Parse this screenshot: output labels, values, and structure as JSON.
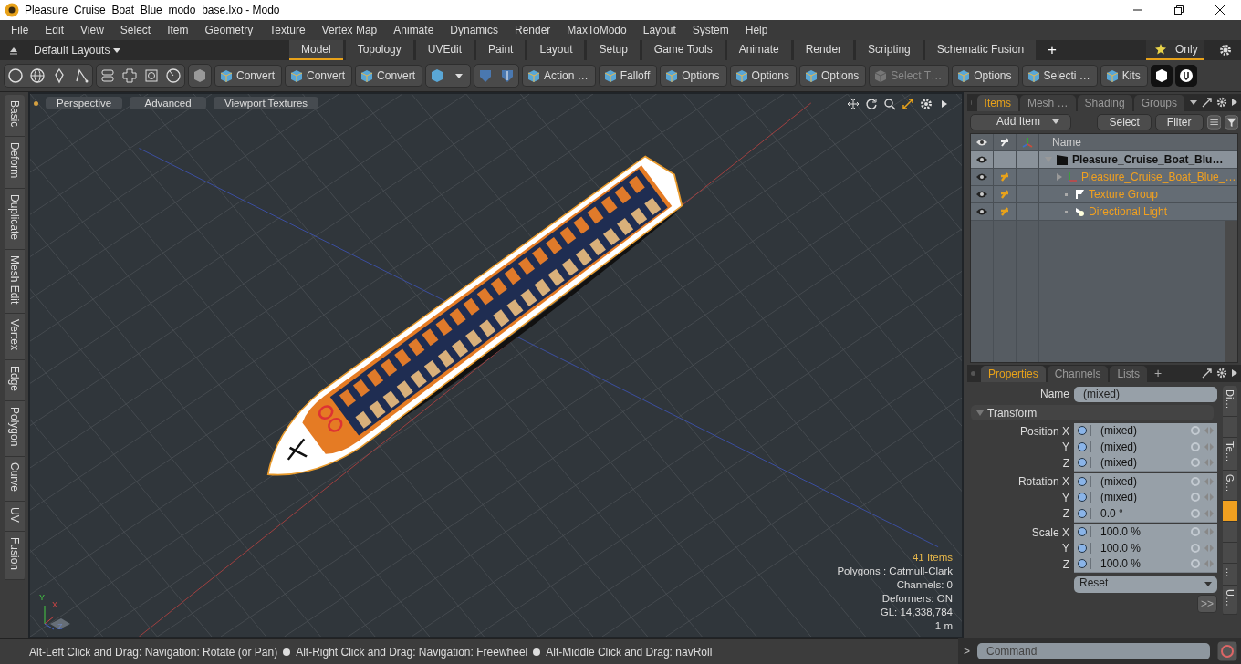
{
  "window": {
    "title": "Pleasure_Cruise_Boat_Blue_modo_base.lxo - Modo"
  },
  "menu": [
    "File",
    "Edit",
    "View",
    "Select",
    "Item",
    "Geometry",
    "Texture",
    "Vertex Map",
    "Animate",
    "Dynamics",
    "Render",
    "MaxToModo",
    "Layout",
    "System",
    "Help"
  ],
  "layout_bar": {
    "layouts": "Default Layouts",
    "tabs": [
      {
        "label": "Model",
        "selected": true
      },
      {
        "label": "Topology",
        "selected": false
      },
      {
        "label": "UVEdit",
        "selected": false
      },
      {
        "label": "Paint",
        "selected": false
      },
      {
        "label": "Layout",
        "selected": false
      },
      {
        "label": "Setup",
        "selected": false
      },
      {
        "label": "Game Tools",
        "selected": false
      },
      {
        "label": "Animate",
        "selected": false
      },
      {
        "label": "Render",
        "selected": false
      },
      {
        "label": "Scripting",
        "selected": false
      },
      {
        "label": "Schematic Fusion",
        "selected": false
      }
    ],
    "add": "+",
    "only": "Only"
  },
  "toolbar": {
    "buttons": [
      {
        "label": "Convert",
        "disabled": false
      },
      {
        "label": "Convert",
        "disabled": false
      },
      {
        "label": "Convert",
        "disabled": false
      },
      {
        "label": "Action …",
        "disabled": false
      },
      {
        "label": "Falloff",
        "disabled": false
      },
      {
        "label": "Options",
        "disabled": false
      },
      {
        "label": "Options",
        "disabled": false
      },
      {
        "label": "Options",
        "disabled": false
      },
      {
        "label": "Select T…",
        "disabled": true
      },
      {
        "label": "Options",
        "disabled": false
      },
      {
        "label": "Selecti …",
        "disabled": false
      },
      {
        "label": "Kits",
        "disabled": false
      }
    ]
  },
  "side_tabs": [
    "Basic",
    "Deform",
    "Duplicate",
    "Mesh Edit",
    "Vertex",
    "Edge",
    "Polygon",
    "Curve",
    "UV",
    "Fusion"
  ],
  "viewport": {
    "tabs": [
      "Perspective",
      "Advanced",
      "Viewport Textures"
    ],
    "stats": [
      {
        "text": "41 Items",
        "highlight": true
      },
      {
        "text": "Polygons : Catmull-Clark",
        "highlight": false
      },
      {
        "text": "Channels: 0",
        "highlight": false
      },
      {
        "text": "Deformers: ON",
        "highlight": false
      },
      {
        "text": "GL: 14,338,784",
        "highlight": false
      },
      {
        "text": "1 m",
        "highlight": false
      }
    ],
    "gizmo_axes": [
      "Y",
      "X",
      "Z"
    ]
  },
  "items_panel": {
    "tabs": [
      {
        "label": "Items",
        "selected": true
      },
      {
        "label": "Mesh …",
        "selected": false
      },
      {
        "label": "Shading",
        "selected": false
      },
      {
        "label": "Groups",
        "selected": false
      }
    ],
    "add_item": "Add Item",
    "select": "Select",
    "filter": "Filter",
    "name_column": "Name",
    "tree": [
      {
        "label": "Pleasure_Cruise_Boat_Blu…",
        "kind": "scene",
        "expanded": true,
        "children": [
          {
            "label": "Pleasure_Cruise_Boat_Blue_…",
            "kind": "mesh",
            "expanded": false
          },
          {
            "label": "Texture Group",
            "kind": "group"
          },
          {
            "label": "Directional Light",
            "kind": "light"
          }
        ]
      }
    ]
  },
  "properties_panel": {
    "tabs": [
      {
        "label": "Properties",
        "selected": true
      },
      {
        "label": "Channels",
        "selected": false
      },
      {
        "label": "Lists",
        "selected": false
      }
    ],
    "add": "+",
    "name_label": "Name",
    "name_value": "(mixed)",
    "section": "Transform",
    "section_expanded": true,
    "groups": [
      {
        "rows": [
          {
            "label": "Position X",
            "value": "(mixed)"
          },
          {
            "label": "Y",
            "value": "(mixed)"
          },
          {
            "label": "Z",
            "value": "(mixed)"
          }
        ]
      },
      {
        "rows": [
          {
            "label": "Rotation X",
            "value": "(mixed)"
          },
          {
            "label": "Y",
            "value": "(mixed)"
          },
          {
            "label": "Z",
            "value": "0.0 °"
          }
        ]
      },
      {
        "rows": [
          {
            "label": "Scale X",
            "value": "100.0 %"
          },
          {
            "label": "Y",
            "value": "100.0 %"
          },
          {
            "label": "Z",
            "value": "100.0 %"
          }
        ]
      }
    ],
    "reset": "Reset",
    "more": ">>",
    "side_tabs": [
      {
        "kind": "label",
        "label": "Di…",
        "selected": false
      },
      {
        "kind": "blank",
        "selected": false
      },
      {
        "kind": "label",
        "label": "Te…",
        "selected": false
      },
      {
        "kind": "label",
        "label": "G…",
        "selected": false
      },
      {
        "kind": "blank",
        "selected": true
      },
      {
        "kind": "blank",
        "selected": false
      },
      {
        "kind": "blank",
        "selected": false
      },
      {
        "kind": "label",
        "label": "…",
        "selected": false
      },
      {
        "kind": "label",
        "label": "U…",
        "selected": false
      }
    ]
  },
  "status_bar": {
    "hints": [
      "Alt-Left Click and Drag: Navigation: Rotate (or Pan)",
      "Alt-Right Click and Drag: Navigation: Freewheel",
      "Alt-Middle Click and Drag: navRoll"
    ]
  },
  "command": {
    "prompt": ">",
    "placeholder": "Command"
  }
}
